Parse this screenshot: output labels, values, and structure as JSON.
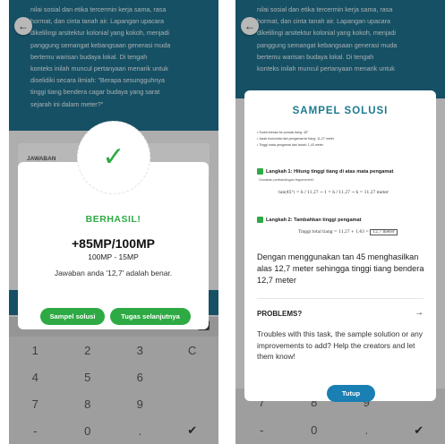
{
  "left_screen": {
    "background_lines": [
      "nilai sosial dan etika tercermin kerja sama, rasa",
      "hormat, dan cinta tanah air. Lapangan upacara",
      "dikelilingi arsitektur kolonial yang kokoh, menjadi",
      "panggung semangat kebangsaan generasi muda",
      "bertemu warisan budaya lokal. Di tengah",
      "konteks inilah muncul pertanyaan menarik untuk",
      "diselidiki secara ilmiah: \"Berapa sesungguhnya",
      "tinggi tiang bendera cagar budaya yang sarat",
      "sejarah ini dalam meter?\""
    ],
    "partial_label": "JAWABAN",
    "modal": {
      "status": "BERHASIL!",
      "mp_result": "+85MP/100MP",
      "mp_breakdown": "100MP - 15MP",
      "answer_message": "Jawaban anda '12,7' adalah benar.",
      "sample_button": "Sampel solusi",
      "next_button": "Tugas selanjutnya"
    },
    "keypad": {
      "row1": [
        "1",
        "2",
        "3",
        "C"
      ],
      "row2": [
        "4",
        "5",
        "6",
        ""
      ],
      "row3": [
        "7",
        "8",
        "9",
        ""
      ],
      "row4": [
        "-",
        "0",
        ".",
        "✔"
      ]
    }
  },
  "right_screen": {
    "background_lines": [
      "nilai sosial dan etika tercermin kerja sama, rasa",
      "hormat, dan cinta tanah air. Lapangan upacara",
      "dikelilingi arsitektur kolonial yang kokoh, menjadi",
      "panggung semangat kebangsaan generasi muda",
      "bertemu warisan budaya lokal. Di tengah",
      "konteks inilah muncul pertanyaan menarik untuk"
    ],
    "modal": {
      "title": "SAMPEL SOLUSI",
      "bullets": [
        "Sudut elevasi ke puncak tiang: 45°",
        "Jarak horizontal dari pengamat ke tiang: 11,27 meter",
        "Tinggi mata pengamat dari tanah: 1,43 meter"
      ],
      "step1": "Langkah 1: Hitung tinggi tiang di atas mata pengamat",
      "step1_note": "Gunakan perbandingan trigonometri:",
      "step1_formula": "tan(45°) = h / 11,27 → 1 = h / 11,27 → h = 11,27 meter",
      "step2": "Langkah 2: Tambahkan tinggi pengamat",
      "step2_formula_prefix": "Tinggi total tiang = 11,27 + 1,43 =",
      "step2_result": "12,7 meter",
      "conclusion": "Dengan menggunakan tan 45 menghasilkan alas 12,7 meter sehingga tinggi tiang bendera 12,7 meter",
      "problems_label": "PROBLEMS?",
      "problems_text": "Troubles with this task, the sample solution or any improvements to add? Help the creators and let them know!",
      "close_button": "Tutup"
    },
    "keypad": {
      "row3": [
        "7",
        "8",
        "9",
        ""
      ],
      "row4": [
        "-",
        "0",
        ".",
        "✔"
      ]
    }
  },
  "colors": {
    "teal": "#1f6f8b",
    "success_green": "#2eaa44",
    "title_teal": "#1d7a91",
    "button_blue": "#1a7fb3"
  }
}
